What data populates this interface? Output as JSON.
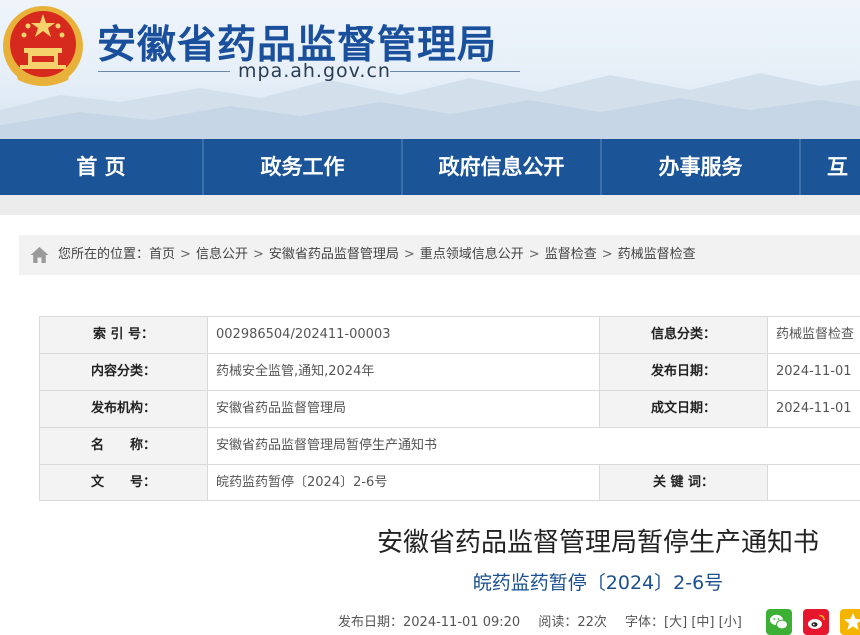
{
  "header": {
    "site_title": "安徽省药品监督管理局",
    "site_domain": "mpa.ah.gov.cn"
  },
  "nav": {
    "items": [
      {
        "label": "首 页"
      },
      {
        "label": "政务工作"
      },
      {
        "label": "政府信息公开"
      },
      {
        "label": "办事服务"
      },
      {
        "label": "互"
      }
    ]
  },
  "breadcrumb": {
    "prefix": "您所在的位置：",
    "items": [
      "首页",
      "信息公开",
      "安徽省药品监督管理局",
      "重点领域信息公开",
      "监督检查",
      "药械监督检查"
    ],
    "separator": ">"
  },
  "meta": {
    "index_label": "索 引 号：",
    "index_value": "002986504/202411-00003",
    "info_category_label": "信息分类：",
    "info_category_value": "药械监督检查",
    "content_category_label": "内容分类：",
    "content_category_value": "药械安全监管,通知,2024年",
    "publish_date_label": "发布日期：",
    "publish_date_value": "2024-11-01",
    "publisher_label": "发布机构：",
    "publisher_value": "安徽省药品监督管理局",
    "created_date_label": "成文日期：",
    "created_date_value": "2024-11-01",
    "name_label": "名　　称：",
    "name_value": "安徽省药品监督管理局暂停生产通知书",
    "doc_no_label": "文　　号：",
    "doc_no_value": "皖药监药暂停〔2024〕2-6号",
    "keywords_label": "关 键 词：",
    "keywords_value": ""
  },
  "article": {
    "title": "安徽省药品监督管理局暂停生产通知书",
    "doc_number": "皖药监药暂停〔2024〕2-6号",
    "publish_label": "发布日期：",
    "publish_datetime": "2024-11-01 09:20",
    "views_label": "阅读：",
    "views": "22次",
    "font_label": "字体：",
    "font_large": "[大]",
    "font_medium": "[中]",
    "font_small": "[小]"
  },
  "colors": {
    "nav_bg": "#1b5497",
    "title_blue": "#1a4f9c",
    "wechat": "#3cb034",
    "weibo": "#e6162d",
    "star": "#f4b400"
  },
  "icons": [
    "national-emblem-icon",
    "home-icon",
    "wechat-icon",
    "weibo-icon",
    "star-icon"
  ]
}
